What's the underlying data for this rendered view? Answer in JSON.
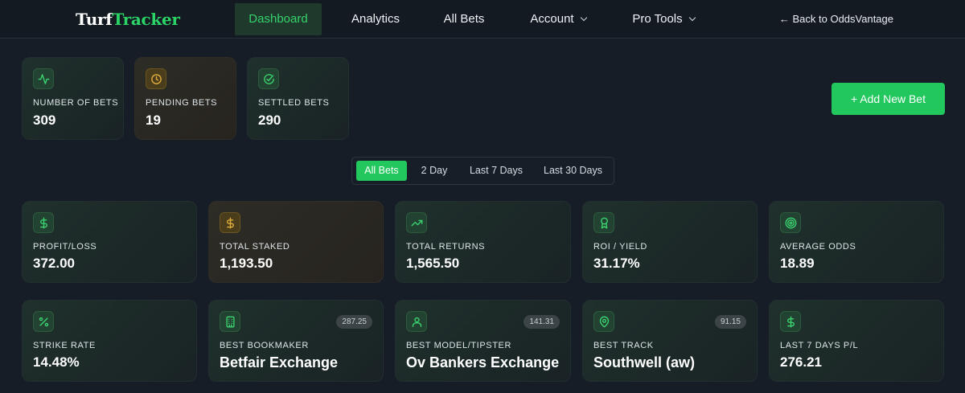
{
  "brand": {
    "part1": "Turf",
    "part2": "Tracker"
  },
  "nav": {
    "dashboard": "Dashboard",
    "analytics": "Analytics",
    "all_bets": "All Bets",
    "account": "Account",
    "pro_tools": "Pro Tools",
    "back": "← Back to OddsVantage"
  },
  "top_stats": [
    {
      "label": "NUMBER OF BETS",
      "value": "309",
      "icon": "activity-icon"
    },
    {
      "label": "PENDING BETS",
      "value": "19",
      "icon": "clock-icon"
    },
    {
      "label": "SETTLED BETS",
      "value": "290",
      "icon": "check-circle-icon"
    }
  ],
  "add_button": "+ Add New Bet",
  "filters": [
    "All Bets",
    "2 Day",
    "Last 7 Days",
    "Last 30 Days"
  ],
  "active_filter": "All Bets",
  "metrics_row1": [
    {
      "label": "PROFIT/LOSS",
      "value": "372.00",
      "icon": "dollar-icon"
    },
    {
      "label": "TOTAL STAKED",
      "value": "1,193.50",
      "icon": "dollar-icon"
    },
    {
      "label": "TOTAL RETURNS",
      "value": "1,565.50",
      "icon": "trending-up-icon"
    },
    {
      "label": "ROI / YIELD",
      "value": "31.17%",
      "icon": "award-icon"
    },
    {
      "label": "AVERAGE ODDS",
      "value": "18.89",
      "icon": "target-icon"
    }
  ],
  "metrics_row2": [
    {
      "label": "STRIKE RATE",
      "value": "14.48%",
      "icon": "percent-icon"
    },
    {
      "label": "BEST BOOKMAKER",
      "value": "Betfair Exchange",
      "badge": "287.25",
      "icon": "building-icon"
    },
    {
      "label": "BEST MODEL/TIPSTER",
      "value": "Ov Bankers Exchange",
      "badge": "141.31",
      "icon": "user-icon"
    },
    {
      "label": "BEST TRACK",
      "value": "Southwell (aw)",
      "badge": "91.15",
      "icon": "map-pin-icon"
    },
    {
      "label": "LAST 7 DAYS P/L",
      "value": "276.21",
      "icon": "dollar-icon"
    }
  ],
  "colors": {
    "accent": "#22c85e",
    "background": "#161d26",
    "amber": "#d9a63a"
  }
}
